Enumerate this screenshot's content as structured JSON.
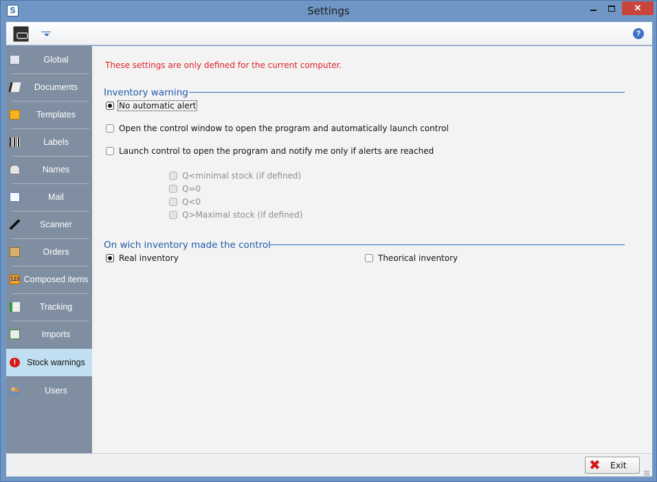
{
  "window": {
    "title": "Settings",
    "app_icon_letter": "S"
  },
  "toolbar": {
    "help_glyph": "?"
  },
  "sidebar": {
    "items": [
      {
        "label": "Global",
        "icon": "global-icon"
      },
      {
        "label": "Documents",
        "icon": "documents-icon"
      },
      {
        "label": "Templates",
        "icon": "templates-icon"
      },
      {
        "label": "Labels",
        "icon": "barcode-icon"
      },
      {
        "label": "Names",
        "icon": "names-icon"
      },
      {
        "label": "Mail",
        "icon": "mail-icon"
      },
      {
        "label": "Scanner",
        "icon": "scanner-icon"
      },
      {
        "label": "Orders",
        "icon": "orders-icon"
      },
      {
        "label": "Composed items",
        "icon": "composed-items-icon"
      },
      {
        "label": "Tracking",
        "icon": "tracking-icon"
      },
      {
        "label": "Imports",
        "icon": "imports-icon"
      },
      {
        "label": "Stock warnings",
        "icon": "stock-warning-icon",
        "active": true
      },
      {
        "label": "Users",
        "icon": "users-icon"
      }
    ],
    "composed_icon_text": "123",
    "stock_icon_text": "!"
  },
  "content": {
    "notice": "These settings are only defined for the current computer.",
    "inventory_warning": {
      "title": "Inventory warning",
      "options": [
        {
          "label": "No automatic alert",
          "selected": true
        },
        {
          "label": "Open the control window to open the program and automatically launch control",
          "selected": false
        },
        {
          "label": "Launch control to open the program and notify me only if alerts are reached",
          "selected": false
        }
      ],
      "conditions": [
        {
          "label": "Q<minimal stock  (if defined)",
          "checked": false
        },
        {
          "label": "Q=0",
          "checked": false
        },
        {
          "label": "Q<0",
          "checked": false
        },
        {
          "label": "Q>Maximal stock (if defined)",
          "checked": false
        }
      ]
    },
    "inventory_control": {
      "title": "On wich inventory made the control",
      "options": [
        {
          "label": "Real inventory",
          "selected": true
        },
        {
          "label": "Theorical inventory",
          "selected": false
        }
      ]
    }
  },
  "footer": {
    "exit_label": "Exit"
  },
  "colors": {
    "title_bar": "#6f96c4",
    "sidebar": "#7f8fa1",
    "active_item": "#c2dff2",
    "notice_red": "#e0202a",
    "group_blue": "#1d5aa8"
  }
}
